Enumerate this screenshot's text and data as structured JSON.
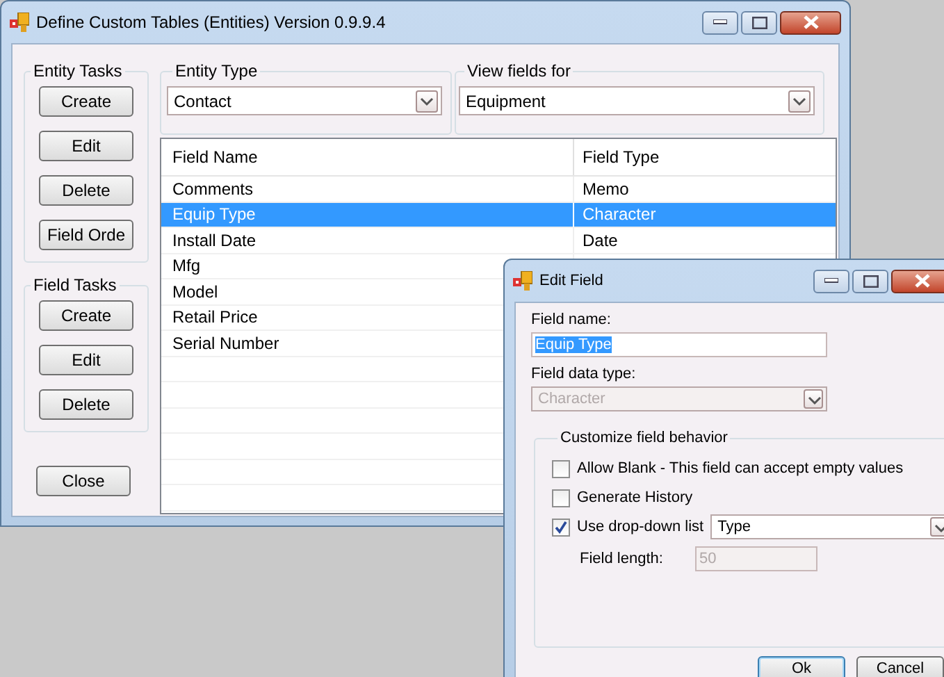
{
  "main_window": {
    "title": "Define Custom Tables (Entities) Version 0.9.9.4",
    "entity_tasks": {
      "title": "Entity Tasks",
      "buttons": [
        "Create",
        "Edit",
        "Delete",
        "Field Orde"
      ]
    },
    "field_tasks": {
      "title": "Field Tasks",
      "buttons": [
        "Create",
        "Edit",
        "Delete"
      ]
    },
    "close_button": "Close",
    "entity_type": {
      "label": "Entity Type",
      "value": "Contact"
    },
    "view_fields_for": {
      "label": "View fields for",
      "value": "Equipment"
    },
    "table": {
      "columns": [
        "Field Name",
        "Field Type"
      ],
      "rows": [
        {
          "cells": [
            "Comments",
            "Memo"
          ],
          "selected": false
        },
        {
          "cells": [
            "Equip Type",
            "Character"
          ],
          "selected": true
        },
        {
          "cells": [
            "Install Date",
            "Date"
          ],
          "selected": false
        },
        {
          "cells": [
            "Mfg"
          ],
          "selected": false
        },
        {
          "cells": [
            "Model"
          ],
          "selected": false
        },
        {
          "cells": [
            "Retail Price"
          ],
          "selected": false
        },
        {
          "cells": [
            "Serial Number"
          ],
          "selected": false
        }
      ]
    }
  },
  "edit_field_dialog": {
    "title": "Edit Field",
    "field_name": {
      "label": "Field name:",
      "value": "Equip Type",
      "text_selected": true
    },
    "field_data_type": {
      "label": "Field data type:",
      "value": "Character",
      "disabled": true
    },
    "behavior": {
      "title": "Customize field behavior",
      "options": [
        {
          "label": "Allow Blank - This field can accept empty values",
          "checked": false
        },
        {
          "label": "Generate History",
          "checked": false
        },
        {
          "label": "Use drop-down list",
          "checked": true
        }
      ],
      "drop_down_list": {
        "value": "Type"
      },
      "field_length": {
        "label": "Field length:",
        "value": "50",
        "disabled": true
      }
    },
    "buttons": [
      "Ok",
      "Cancel"
    ]
  }
}
